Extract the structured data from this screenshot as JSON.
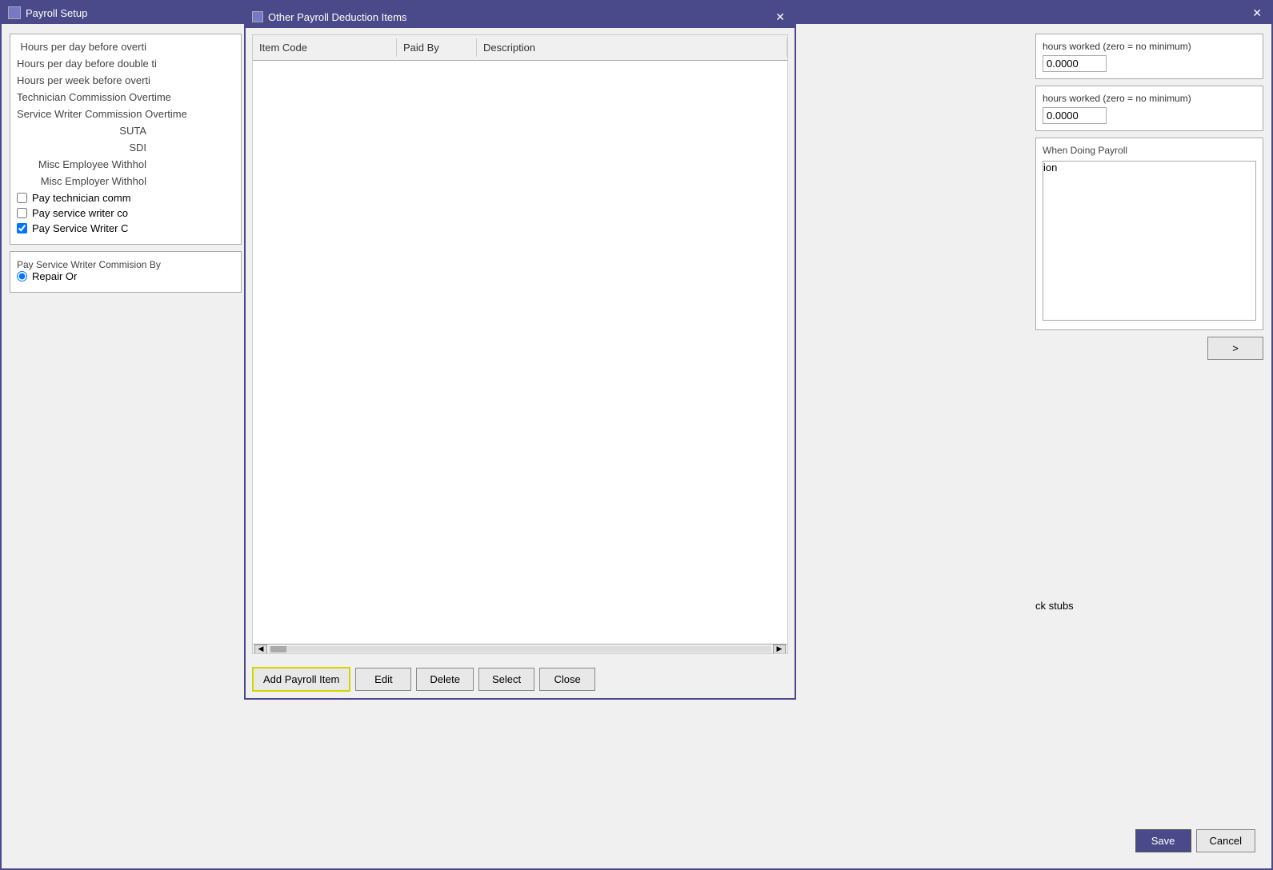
{
  "mainWindow": {
    "title": "Payroll Setup",
    "closeBtn": "✕",
    "iconLabel": "payroll-icon"
  },
  "dialog": {
    "title": "Other Payroll Deduction Items",
    "closeBtn": "✕",
    "table": {
      "columns": [
        {
          "id": "item-code",
          "label": "Item Code"
        },
        {
          "id": "paid-by",
          "label": "Paid By"
        },
        {
          "id": "description",
          "label": "Description"
        }
      ],
      "rows": []
    },
    "buttons": {
      "addPayrollItem": "Add Payroll Item",
      "edit": "Edit",
      "delete": "Delete",
      "select": "Select",
      "close": "Close"
    }
  },
  "rightPanel": {
    "section1": {
      "labelHoursWorked1": "hours worked  (zero = no minimum)",
      "value1": "0.0000",
      "labelHoursWorked2": "hours worked  (zero = no minimum)",
      "value2": "0.0000"
    },
    "section2": {
      "heading": "When Doing Payroll",
      "textPlaceholder": "ion"
    }
  },
  "leftPanel": {
    "rows": [
      {
        "label": "Hours per day before overti"
      },
      {
        "label": "Hours per day before double ti"
      },
      {
        "label": "Hours per week before overti"
      },
      {
        "label": "Technician Commission Overtime"
      },
      {
        "label": "Service Writer Commission Overtime"
      },
      {
        "label": "SUTA"
      },
      {
        "label": "SDI"
      },
      {
        "label": "Misc Employee Withho"
      },
      {
        "label": "Misc Employer Withho"
      }
    ],
    "checkboxes": [
      {
        "label": "Pay technician comm",
        "checked": false
      },
      {
        "label": "Pay service writer co",
        "checked": false
      },
      {
        "label": "Pay Service Writer C",
        "checked": true
      }
    ],
    "commissionSection": {
      "label": "Pay Service Writer Commision By",
      "radio": "Repair Or"
    }
  },
  "saveCancelBar": {
    "saveBtn": "Save",
    "cancelBtn": "Cancel"
  },
  "rightBottom": {
    "checkStubs": "ck stubs"
  }
}
